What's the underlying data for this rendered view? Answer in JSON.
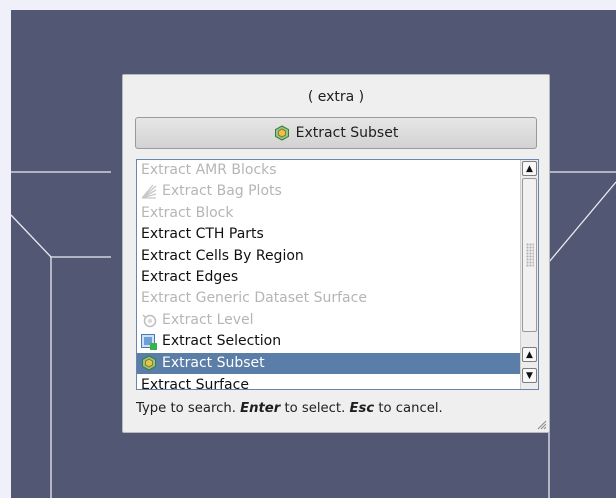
{
  "category_title": "( extra )",
  "favorite_button": {
    "label": "Extract Subset",
    "icon": "extract-subset-icon"
  },
  "filters": [
    {
      "label": "Extract AMR Blocks",
      "enabled": false,
      "icon": null
    },
    {
      "label": "Extract Bag Plots",
      "enabled": false,
      "icon": "bag-plot-icon"
    },
    {
      "label": "Extract Block",
      "enabled": false,
      "icon": null
    },
    {
      "label": "Extract CTH Parts",
      "enabled": true,
      "icon": null
    },
    {
      "label": "Extract Cells By Region",
      "enabled": true,
      "icon": null
    },
    {
      "label": "Extract Edges",
      "enabled": true,
      "icon": null
    },
    {
      "label": "Extract Generic Dataset Surface",
      "enabled": false,
      "icon": null
    },
    {
      "label": "Extract Level",
      "enabled": false,
      "icon": "extract-level-icon"
    },
    {
      "label": "Extract Selection",
      "enabled": true,
      "icon": "extract-selection-icon"
    },
    {
      "label": "Extract Subset",
      "enabled": true,
      "icon": "extract-subset-icon",
      "selected": true
    },
    {
      "label": "Extract Surface",
      "enabled": true,
      "icon": null,
      "partial": true
    }
  ],
  "hint": {
    "prefix": "Type to search. ",
    "enter_key": "Enter",
    "middle": " to select. ",
    "esc_key": "Esc",
    "suffix": " to cancel."
  },
  "colors": {
    "viewport_bg": "#525873",
    "selection_bg": "#5a7ea8",
    "disabled_text": "#b5b5b5"
  }
}
